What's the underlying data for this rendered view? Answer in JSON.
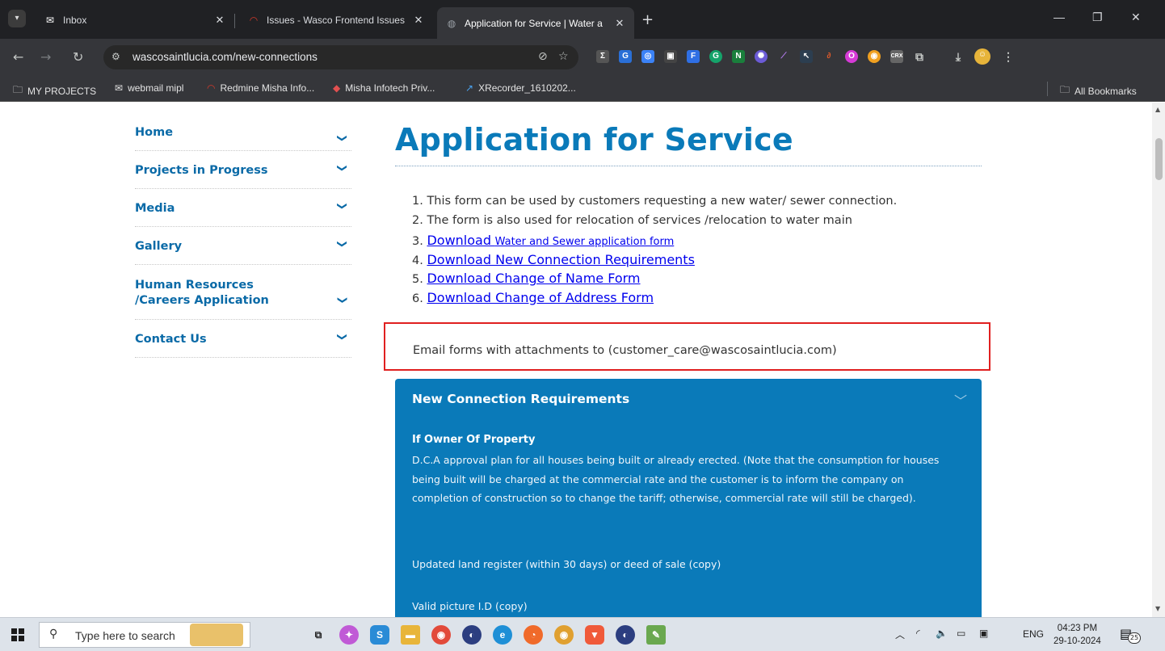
{
  "browser": {
    "tabs": [
      {
        "title": "Inbox",
        "favicon": "cd-mail-icon",
        "active": false
      },
      {
        "title": "Issues - Wasco Frontend Issues",
        "favicon": "redmine-icon",
        "active": false
      },
      {
        "title": "Application for Service | Water a",
        "favicon": "globe-icon",
        "active": true
      }
    ],
    "url": "wascosaintlucia.com/new-connections",
    "bookmarks": [
      {
        "label": "MY PROJECTS",
        "icon": "folder-icon"
      },
      {
        "label": "webmail mipl",
        "icon": "cd-mail-icon"
      },
      {
        "label": "Redmine Misha Info...",
        "icon": "redmine-icon"
      },
      {
        "label": "Misha Infotech Priv...",
        "icon": "misha-icon"
      },
      {
        "label": "XRecorder_1610202...",
        "icon": "xrecorder-icon"
      }
    ],
    "all_bookmarks": "All Bookmarks"
  },
  "sidebar": {
    "items": [
      {
        "label": "Home"
      },
      {
        "label": "Projects in Progress"
      },
      {
        "label": "Media"
      },
      {
        "label": "Gallery"
      },
      {
        "label": "Human Resources /Careers Application"
      },
      {
        "label": "Contact Us"
      }
    ]
  },
  "main": {
    "title": "Application for Service",
    "list": [
      {
        "num": "1.",
        "text": "This form can be used by customers requesting a new water/ sewer connection."
      },
      {
        "num": "2.",
        "text": "The form is also used for relocation of services /relocation to water main"
      },
      {
        "num": "3.",
        "link": "Download",
        "link_small": "Water and Sewer application form"
      },
      {
        "num": "4.",
        "link": "Download New Connection Requirements"
      },
      {
        "num": "5.",
        "link": "Download Change of Name Form"
      },
      {
        "num": "6.",
        "link": "Download Change of Address Form"
      }
    ],
    "email_note": "Email forms with attachments to (customer_care@wascosaintlucia.com)",
    "accordion": {
      "heading": "New Connection Requirements",
      "owner_heading": "If Owner Of Property",
      "paragraph": "D.C.A approval plan for all houses being built or already erected. (Note that the consumption for houses being built will be charged at the commercial rate and the customer is to inform the company on completion of construction so to change the tariff; otherwise, commercial rate will still be charged).",
      "item_2": "Updated land register (within 30 days) or deed of sale (copy)",
      "item_3": "Valid picture I.D (copy)"
    }
  },
  "taskbar": {
    "search_placeholder": "Type here to search",
    "language": "ENG",
    "time": "04:23 PM",
    "date": "29-10-2024",
    "notification_count": "25"
  },
  "colors": {
    "brand_blue": "#0a7ab9",
    "highlight_red": "#e02020",
    "link": "#0000ee"
  }
}
